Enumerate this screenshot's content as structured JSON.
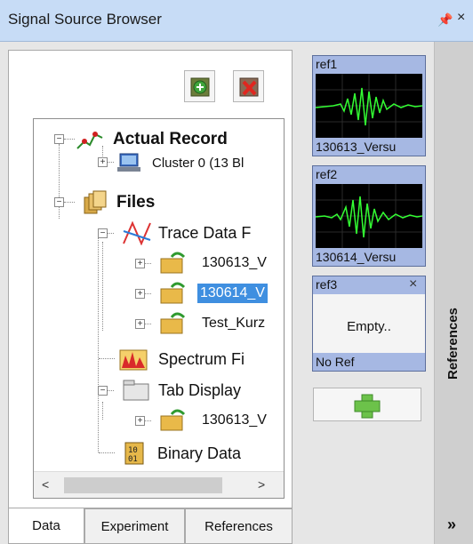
{
  "window": {
    "title": "Signal Source Browser"
  },
  "tree": {
    "actual_record": "Actual Record",
    "cluster": "Cluster 0 (13 Bl",
    "files": "Files",
    "trace_data": "Trace Data F",
    "file1": "130613_V",
    "file2": "130614_V",
    "file3": "Test_Kurz",
    "spectrum": "Spectrum Fi",
    "tab_display": "Tab Display",
    "tab_file": "130613_V",
    "binary": "Binary Data"
  },
  "tabs": [
    "Data",
    "Experiment",
    "References"
  ],
  "references": {
    "panel_title": "References",
    "cards": [
      {
        "name": "ref1",
        "footer": "130613_Versu"
      },
      {
        "name": "ref2",
        "footer": "130614_Versu"
      },
      {
        "name": "ref3",
        "body": "Empty..",
        "footer": "No Ref",
        "close": "×"
      }
    ],
    "more": "»"
  },
  "icons": {
    "pin": "pin-icon",
    "close": "close-icon",
    "add": "plus-icon"
  },
  "colors": {
    "title_bar": "#c7dcf6",
    "selection": "#3f8fe0",
    "ref_card": "#a6b8e3",
    "signal": "#33ff33",
    "add_icon": "#6cc24a"
  }
}
